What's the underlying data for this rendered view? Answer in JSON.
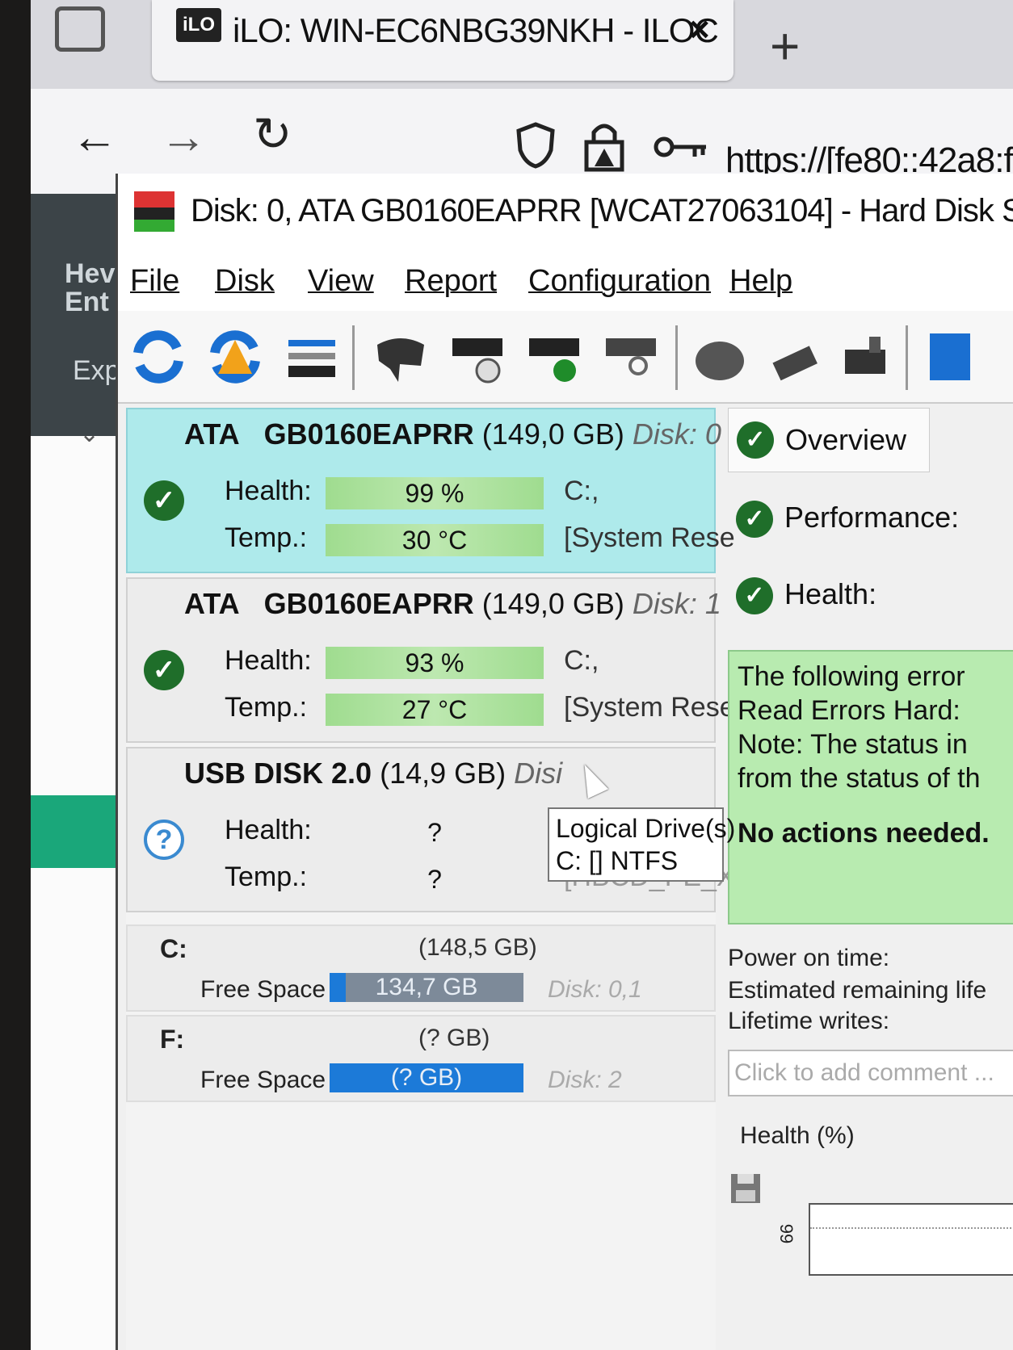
{
  "browser": {
    "tab_favicon": "iLO",
    "tab_title": "iLO: WIN-EC6NBG39NKH - ILOC",
    "tab_close": "×",
    "new_tab": "+",
    "url": "https://[fe80::42a8:f"
  },
  "background_page": {
    "sidebar_text_1": "Hev",
    "sidebar_text_2": "Ent",
    "sidebar_text_3": "Exp"
  },
  "window": {
    "title": "Disk: 0, ATA    GB0160EAPRR [WCAT27063104]  -  Hard Disk Ser"
  },
  "menu": [
    "File",
    "Disk",
    "View",
    "Report",
    "Configuration",
    "Help"
  ],
  "disks": [
    {
      "bus": "ATA",
      "model": "GB0160EAPRR",
      "size": "(149,0 GB)",
      "disk_label": "Disk: 0",
      "health_label": "Health:",
      "health": "99 %",
      "temp_label": "Temp.:",
      "temp": "30 °C",
      "drive1": "C:,",
      "drive2": "[System Rese"
    },
    {
      "bus": "ATA",
      "model": "GB0160EAPRR",
      "size": "(149,0 GB)",
      "disk_label": "Disk: 1",
      "health_label": "Health:",
      "health": "93 %",
      "temp_label": "Temp.:",
      "temp": "27 °C",
      "drive1": "C:,",
      "drive2": "[System Rese"
    },
    {
      "bus": "USB DISK 2.0",
      "model": "",
      "size": "(14,9 GB)",
      "disk_label": "Disi",
      "health_label": "Health:",
      "health": "?",
      "temp_label": "Temp.:",
      "temp": "?",
      "drive1": "",
      "drive2": "[HBCD_PE_X("
    }
  ],
  "volumes": [
    {
      "letter": "C:",
      "size": "(148,5 GB)",
      "free_label": "Free Space",
      "free": "134,7 GB",
      "disks": "Disk: 0,1"
    },
    {
      "letter": "F:",
      "size": "(? GB)",
      "free_label": "Free Space",
      "free": "(? GB)",
      "disks": "Disk: 2"
    }
  ],
  "tooltip": {
    "line1": "Logical Drive(s)",
    "line2": "C: [] NTFS"
  },
  "right": {
    "overview": "Overview",
    "performance": "Performance:",
    "health": "Health:",
    "msg1": "The following error",
    "msg2": "Read Errors Hard:",
    "msg3": "Note: The status in",
    "msg4": "from the status of th",
    "msg5": "No actions needed.",
    "power_on": "Power on time:",
    "remaining": "Estimated remaining life",
    "writes": "Lifetime writes:",
    "comment_placeholder": "Click to add comment ...",
    "health_pct": "Health (%)",
    "axis_tick": "99"
  },
  "colors": {
    "selected_disk": "#aeeaeb",
    "health_bar": "#9fdc8f",
    "ok_icon": "#1f6e2a",
    "free_space_bar": "#1c7ad8",
    "message_box": "#b8ebb0"
  }
}
